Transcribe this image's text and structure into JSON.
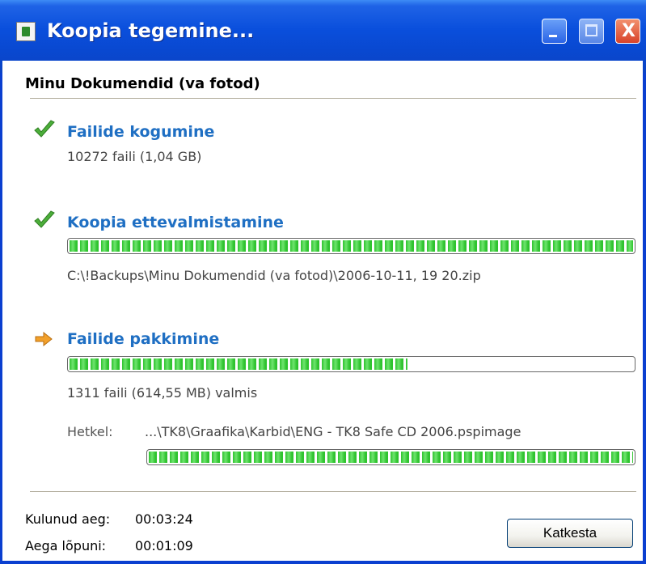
{
  "window": {
    "title": "Koopia tegemine...",
    "controls": {
      "close_symbol": "X"
    }
  },
  "header": {
    "job_name": "Minu Dokumendid (va fotod)"
  },
  "steps": [
    {
      "title": "Failide kogumine",
      "detail": "10272 faili (1,04 GB)",
      "status": "done",
      "icon": "check-icon"
    },
    {
      "title": "Koopia ettevalmistamine",
      "detail": "C:\\!Backups\\Minu Dokumendid (va fotod)\\2006-10-11, 19 20.zip",
      "status": "done",
      "icon": "check-icon",
      "progress": 1.0
    },
    {
      "title": "Failide pakkimine",
      "detail": "1311 faili (614,55 MB) valmis",
      "status": "active",
      "icon": "arrow-icon",
      "progress": 0.6
    }
  ],
  "current": {
    "label": "Hetkel:",
    "file": "...\\TK8\\Graafika\\Karbid\\ENG - TK8 Safe CD 2006.pspimage",
    "progress": 1.0
  },
  "footer": {
    "elapsed_label": "Kulunud aeg:",
    "elapsed_value": "00:03:24",
    "remaining_label": "Aega lõpuni:",
    "remaining_value": "00:01:09",
    "cancel_label": "Katkesta"
  },
  "colors": {
    "title_bar": "#0a4fdc",
    "step_title": "#1f6fc3",
    "progress_fill": "#2fc32f",
    "check": "#4cae3a",
    "arrow": "#f2a02a"
  }
}
